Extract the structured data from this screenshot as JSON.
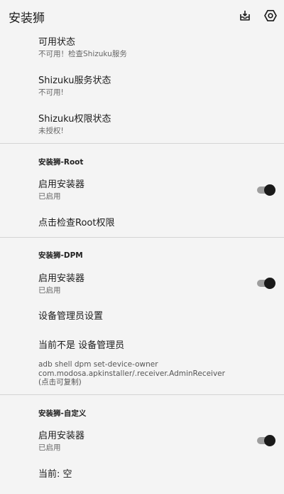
{
  "app": {
    "title": "安装狮",
    "icons": {
      "left": "inbox-download-icon",
      "right": "settings-hexagon-icon"
    }
  },
  "shizuku": {
    "available": {
      "title": "可用状态",
      "summary": "不可用！检查Shizuku服务"
    },
    "service": {
      "title": "Shizuku服务状态",
      "summary": "不可用!"
    },
    "permission": {
      "title": "Shizuku权限状态",
      "summary": "未授权!"
    }
  },
  "root": {
    "category": "安装狮-Root",
    "enable": {
      "title": "启用安装器",
      "summary": "已启用",
      "checked": true
    },
    "check": {
      "title": "点击检查Root权限"
    }
  },
  "dpm": {
    "category": "安装狮-DPM",
    "enable": {
      "title": "启用安装器",
      "summary": "已启用",
      "checked": true
    },
    "admin_settings": {
      "title": "设备管理员设置"
    },
    "current": {
      "title": "当前不是 设备管理员",
      "line1": "adb shell dpm set-device-owner",
      "line2": "com.modosa.apkinstaller/.receiver.AdminReceiver",
      "line3": "(点击可复制)"
    }
  },
  "custom": {
    "category": "安装狮-自定义",
    "enable": {
      "title": "启用安装器",
      "summary": "已启用",
      "checked": true
    },
    "current": {
      "title": "当前: 空"
    }
  },
  "colors": {
    "background": "#f4f4f4",
    "switch_thumb": "#1a1a1a",
    "switch_track": "#9e9e9e"
  }
}
